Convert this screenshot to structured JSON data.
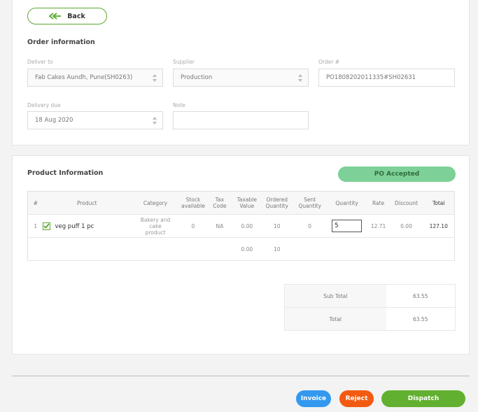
{
  "back_label": "Back",
  "order_info": {
    "title": "Order information",
    "deliver_to": {
      "label": "Deliver to",
      "value": "Fab Cakes Aundh, Pune(SH0263)"
    },
    "supplier": {
      "label": "Supplier",
      "value": "Production"
    },
    "order_no": {
      "label": "Order #",
      "value": "PO1808202011335#SH02631"
    },
    "delivery_due": {
      "label": "Delivery due",
      "value": "18 Aug 2020"
    },
    "note": {
      "label": "Note",
      "value": ""
    }
  },
  "product_info": {
    "title": "Product Information",
    "status": "PO Accepted",
    "columns": {
      "num": "#",
      "product": "Product",
      "category": "Category",
      "stock_1": "Stock",
      "stock_2": "available",
      "tax_1": "Tax",
      "tax_2": "Code",
      "taxable_1": "Taxable",
      "taxable_2": "Value",
      "ordered_1": "Ordered",
      "ordered_2": "Quantity",
      "sent_1": "Sent",
      "sent_2": "Quantity",
      "quantity": "Quantity",
      "rate": "Rate",
      "discount": "Discount",
      "total": "Total"
    },
    "rows": [
      {
        "num": "1",
        "product": "veg puff 1 pc",
        "category_1": "Bakery and",
        "category_2": "cake",
        "category_3": "product",
        "stock": "0",
        "tax_code": "NA",
        "taxable": "0.00",
        "ordered": "10",
        "sent": "0",
        "quantity": "5",
        "rate": "12.71",
        "discount": "0.00",
        "total": "127.10"
      }
    ],
    "footer": {
      "taxable": "0.00",
      "ordered": "10"
    }
  },
  "totals": {
    "sub_total_label": "Sub Total",
    "sub_total_value": "63.55",
    "total_label": "Total",
    "total_value": "63.55"
  },
  "actions": {
    "invoice": "Invoice",
    "reject": "Reject",
    "dispatch": "Dispatch"
  },
  "colors": {
    "accent_green": "#62b02f",
    "status_green": "#7dd097",
    "invoice_blue": "#3399ee",
    "reject_orange": "#f25a12"
  }
}
